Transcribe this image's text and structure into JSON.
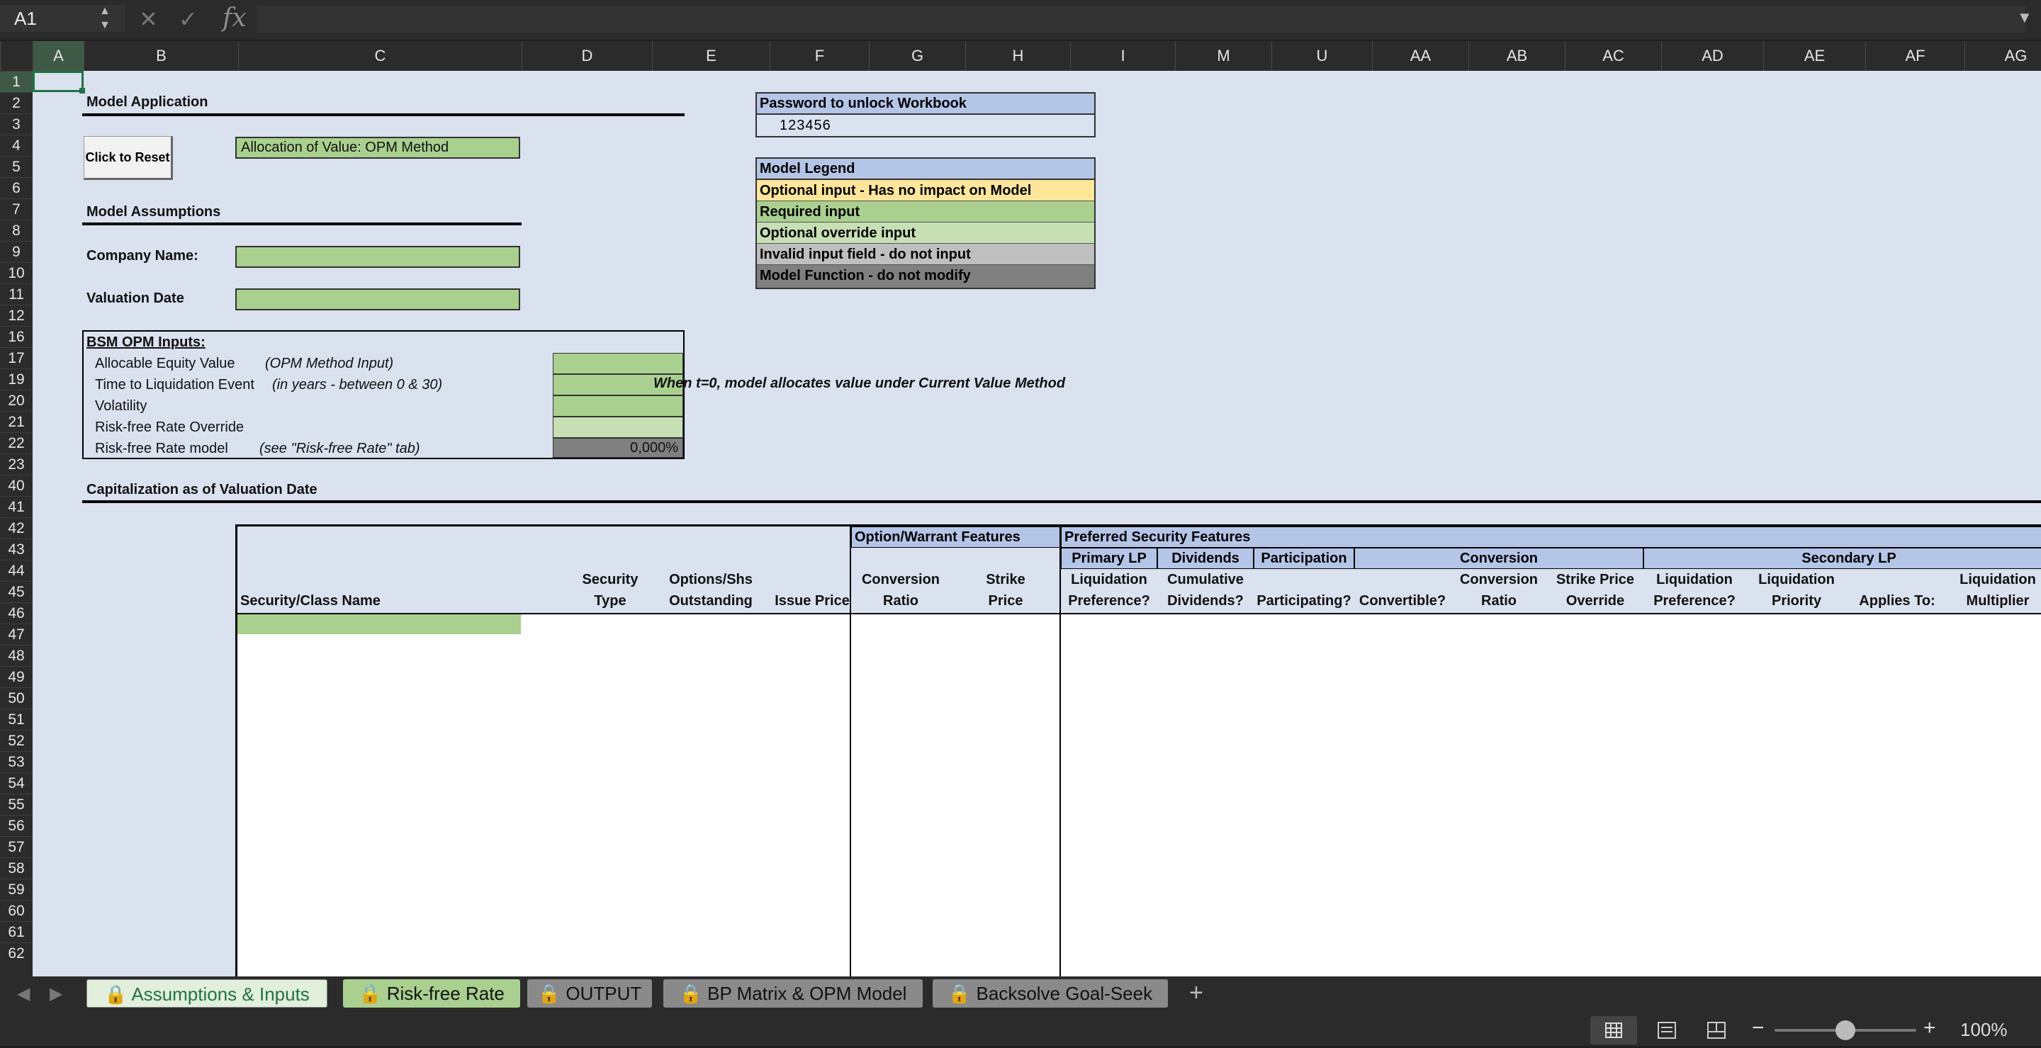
{
  "formula_bar": {
    "name_box": "A1",
    "cancel_icon": "close-icon",
    "enter_icon": "check-icon",
    "fx_label": "fx",
    "formula": ""
  },
  "columns": [
    "A",
    "B",
    "C",
    "D",
    "E",
    "F",
    "G",
    "H",
    "I",
    "M",
    "U",
    "AA",
    "AB",
    "AC",
    "AD",
    "AE",
    "AF",
    "AG"
  ],
  "rows": [
    "1",
    "2",
    "3",
    "4",
    "5",
    "6",
    "7",
    "8",
    "9",
    "10",
    "11",
    "12",
    "16",
    "17",
    "19",
    "20",
    "21",
    "22",
    "23",
    "40",
    "41",
    "42",
    "43",
    "44",
    "45",
    "46",
    "47",
    "48",
    "49",
    "50",
    "51",
    "52",
    "53",
    "54",
    "55",
    "56",
    "57",
    "58",
    "59",
    "60",
    "61",
    "62"
  ],
  "model_application": {
    "title": "Model Application",
    "reset_button": "Click to Reset",
    "method": "Allocation of Value: OPM Method"
  },
  "model_assumptions": {
    "title": "Model Assumptions",
    "company_label": "Company Name:",
    "company_value": "",
    "date_label": "Valuation Date",
    "date_value": ""
  },
  "password": {
    "title": "Password to unlock Workbook",
    "value": "123456"
  },
  "legend": {
    "title": "Model Legend",
    "items": [
      {
        "label": "Optional input - Has no impact on Model",
        "color": "#ffe699"
      },
      {
        "label": "Required input",
        "color": "#a9d08e"
      },
      {
        "label": "Optional override input",
        "color": "#c6e0b4"
      },
      {
        "label": "Invalid input field - do not input",
        "color": "#bfbfbf"
      },
      {
        "label": "Model Function - do not modify",
        "color": "#808080"
      }
    ]
  },
  "bsm": {
    "title": "BSM OPM Inputs:",
    "rows": [
      {
        "label": "Allocable Equity Value",
        "note": "(OPM Method Input)",
        "value": ""
      },
      {
        "label": "Time to Liquidation Event",
        "note": "(in years - between 0 & 30)",
        "value": ""
      },
      {
        "label": "Volatility",
        "note": "",
        "value": ""
      },
      {
        "label": "Risk-free Rate Override",
        "note": "",
        "value": ""
      },
      {
        "label": "Risk-free Rate model",
        "note": "(see \"Risk-free Rate\" tab)",
        "value": "0,000%"
      }
    ],
    "t0_note": "When t=0, model allocates value under Current Value Method"
  },
  "capitalization": {
    "title": "Capitalization as of Valuation Date",
    "group_option": "Option/Warrant Features",
    "group_preferred": "Preferred Security Features",
    "sub_primary": "Primary LP",
    "sub_dividends": "Dividends",
    "sub_participation": "Participation",
    "sub_conversion": "Conversion",
    "sub_secondary": "Secondary LP",
    "headers": {
      "security_name": "Security/Class Name",
      "security_type_1": "Security",
      "security_type_2": "Type",
      "options_1": "Options/Shs",
      "options_2": "Outstanding",
      "issue_price": "Issue Price",
      "conv_ratio_1": "Conversion",
      "conv_ratio_2": "Ratio",
      "strike_1": "Strike",
      "strike_2": "Price",
      "liq_pref_1": "Liquidation",
      "liq_pref_2": "Preference?",
      "cum_div_1": "Cumulative",
      "cum_div_2": "Dividends?",
      "participating": "Participating?",
      "convertible": "Convertible?",
      "pconv_ratio_1": "Conversion",
      "pconv_ratio_2": "Ratio",
      "strike_override_1": "Strike Price",
      "strike_override_2": "Override",
      "sec_liq_pref_1": "Liquidation",
      "sec_liq_pref_2": "Preference?",
      "sec_liq_prio_1": "Liquidation",
      "sec_liq_prio_2": "Priority",
      "applies_to": "Applies To:",
      "liq_mult_1": "Liquidation",
      "liq_mult_2": "Multiplier"
    }
  },
  "tabs": [
    {
      "label": "Assumptions & Inputs",
      "active": true,
      "locked": true
    },
    {
      "label": "Risk-free Rate",
      "active": false,
      "locked": true
    },
    {
      "label": "OUTPUT",
      "active": false,
      "locked": true
    },
    {
      "label": "BP Matrix & OPM Model",
      "active": false,
      "locked": true
    },
    {
      "label": "Backsolve Goal-Seek",
      "active": false,
      "locked": true
    }
  ],
  "status": {
    "zoom": "100%",
    "zoom_level": 0.5
  }
}
